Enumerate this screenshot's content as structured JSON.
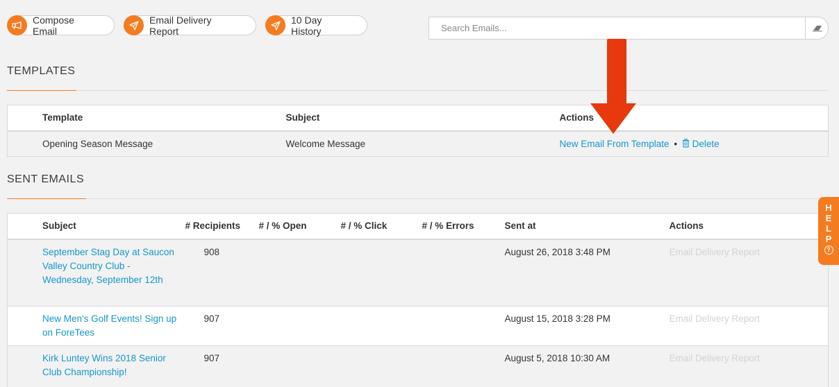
{
  "toolbar": {
    "compose_label": "Compose Email",
    "delivery_report_label": "Email Delivery Report",
    "history_label": "10 Day History"
  },
  "search": {
    "placeholder": "Search Emails..."
  },
  "templates": {
    "section_title": "TEMPLATES",
    "columns": [
      "Template",
      "Subject",
      "Actions"
    ],
    "rows": [
      {
        "template": "Opening Season Message",
        "subject": "Welcome Message",
        "action_new": "New Email From Template",
        "separator": "•",
        "action_delete": "Delete"
      }
    ]
  },
  "sent_emails": {
    "section_title": "SENT EMAILS",
    "columns": [
      "Subject",
      "# Recipients",
      "# / % Open",
      "# / % Click",
      "# / % Errors",
      "Sent at",
      "Actions"
    ],
    "rows": [
      {
        "subject": "September Stag Day at Saucon Valley Country Club - Wednesday, September 12th",
        "recipients": "908",
        "sent_at": "August 26, 2018 3:48 PM",
        "action": "Email Delivery Report"
      },
      {
        "subject": "New Men's Golf Events! Sign up on ForeTees",
        "recipients": "907",
        "sent_at": "August 15, 2018 3:28 PM",
        "action": "Email Delivery Report"
      },
      {
        "subject": "Kirk Luntey Wins 2018 Senior Club Championship!",
        "recipients": "907",
        "sent_at": "August 5, 2018 10:30 AM",
        "action": "Email Delivery Report"
      }
    ]
  },
  "help": {
    "letters": [
      "H",
      "E",
      "L",
      "P"
    ],
    "icon_text": "?"
  },
  "colors": {
    "accent": "#f47b20",
    "link": "#1696c7",
    "annotation_arrow": "#e8380d"
  }
}
